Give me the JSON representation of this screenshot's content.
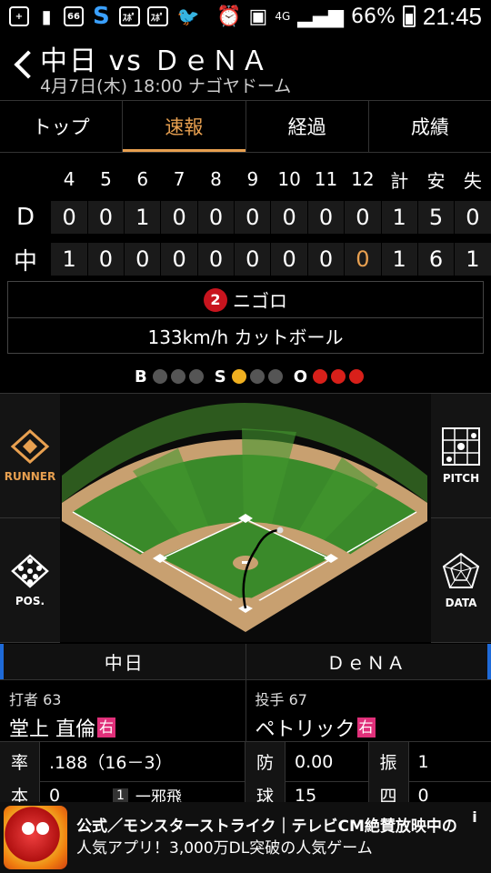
{
  "status_bar": {
    "icon1": "+",
    "icon3": "66",
    "icon5": "ｽﾎﾟ",
    "icon6": "ｽﾎﾟ",
    "network": "4G",
    "battery": "66%",
    "time": "21:45"
  },
  "header": {
    "title": "中日 vs ＤｅＮＡ",
    "subtitle": "4月7日(木) 18:00 ナゴヤドーム"
  },
  "tabs": [
    {
      "label": "トップ"
    },
    {
      "label": "速報"
    },
    {
      "label": "経過"
    },
    {
      "label": "成績"
    }
  ],
  "scoreboard": {
    "headers": [
      "4",
      "5",
      "6",
      "7",
      "8",
      "9",
      "10",
      "11",
      "12",
      "計",
      "安",
      "失"
    ],
    "rows": [
      {
        "team": "D",
        "cells": [
          "0",
          "0",
          "1",
          "0",
          "0",
          "0",
          "0",
          "0",
          "0",
          "1",
          "5",
          "0"
        ]
      },
      {
        "team": "中",
        "cells": [
          "1",
          "0",
          "0",
          "0",
          "0",
          "0",
          "0",
          "0",
          "0",
          "1",
          "6",
          "1"
        ]
      }
    ]
  },
  "play": {
    "outs": "2",
    "result": "ニゴロ",
    "pitch": "133km/h カットボール"
  },
  "count": {
    "b_label": "B",
    "s_label": "S",
    "o_label": "O",
    "balls": 0,
    "strikes": 1,
    "outs": 3,
    "ball_color": "#555555",
    "strike_color": "#f0b020",
    "out_color": "#d8201a"
  },
  "side_buttons": {
    "runner": "RUNNER",
    "pos": "POS.",
    "pitch": "PITCH",
    "data": "DATA"
  },
  "lineup": {
    "home_team": "中日",
    "away_team": "ＤｅＮＡ",
    "batter_role": "打者 63",
    "batter_name": "堂上 直倫",
    "batter_hand": "右",
    "pitcher_role": "投手 67",
    "pitcher_name": "ペトリック",
    "pitcher_hand": "右",
    "stat_avg_k": "率",
    "stat_avg_v": ".188（16－3）",
    "stat_era_k": "防",
    "stat_era_v": "0.00",
    "stat_so_k": "振",
    "stat_so_v": "1",
    "row2_k1": "本",
    "row2_v1": "0",
    "row2_inning": "1",
    "row2_play": "一邪飛",
    "row2_k2": "球",
    "row2_v2": "15",
    "row2_k3": "四",
    "row2_v3": "0"
  },
  "ad": {
    "title": "公式／モンスターストライク｜テレビCM絶賛放映中の",
    "body": "人気アプリ！3,000万DL突破の人気ゲーム",
    "info": "i"
  }
}
